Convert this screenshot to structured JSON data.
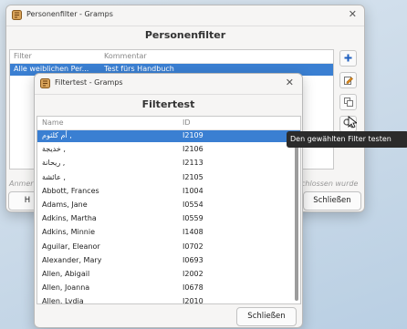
{
  "personenfilter": {
    "window_title": "Personenfilter - Gramps",
    "heading": "Personenfilter",
    "col_filter": "Filter",
    "col_kommentar": "Kommentar",
    "row_filter": "Alle weiblichen Per...",
    "row_kommentar": "Test fürs Handbuch",
    "anmerk_fragment": "Anmer",
    "status_fragment": "chlossen wurde",
    "left_btn_fragment": "H",
    "close_button": "Schließen"
  },
  "filtertest": {
    "window_title": "Filtertest - Gramps",
    "heading": "Filtertest",
    "col_name": "Name",
    "col_id": "ID",
    "rows": [
      {
        "name": "أم كلثوم ,",
        "id": "I2109"
      },
      {
        "name": "خديجة ,",
        "id": "I2106"
      },
      {
        "name": "ريحانة ,",
        "id": "I2113"
      },
      {
        "name": "عائشة ,",
        "id": "I2105"
      },
      {
        "name": "Abbott, Frances",
        "id": "I1004"
      },
      {
        "name": "Adams, Jane",
        "id": "I0554"
      },
      {
        "name": "Adkins, Martha",
        "id": "I0559"
      },
      {
        "name": "Adkins, Minnie",
        "id": "I1408"
      },
      {
        "name": "Aguilar, Eleanor",
        "id": "I0702"
      },
      {
        "name": "Alexander, Mary",
        "id": "I0693"
      },
      {
        "name": "Allen, Abigail",
        "id": "I2002"
      },
      {
        "name": "Allen, Joanna",
        "id": "I0678"
      },
      {
        "name": "Allen, Lydia",
        "id": "I2010"
      }
    ],
    "close_button": "Schließen"
  },
  "tooltip": "Den gewählten Filter testen",
  "icons": [
    "add-icon",
    "edit-icon",
    "copy-icon",
    "test-filter-icon"
  ],
  "colors": {
    "selection": "#3a7fd2",
    "accent_blue": "#1f5fbf"
  }
}
